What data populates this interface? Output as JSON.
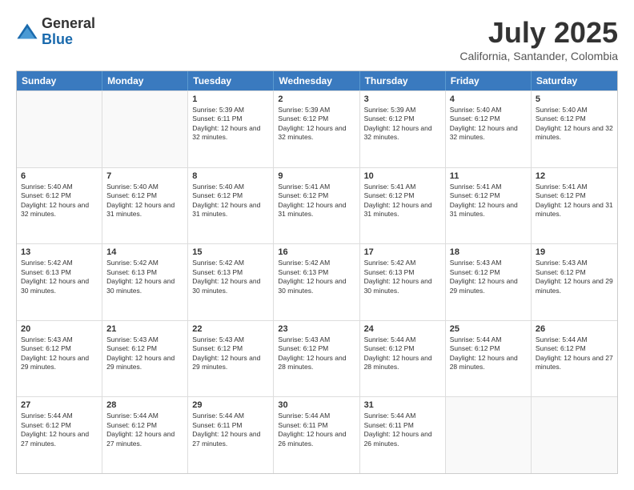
{
  "logo": {
    "line1": "General",
    "line2": "Blue"
  },
  "title": "July 2025",
  "subtitle": "California, Santander, Colombia",
  "header_days": [
    "Sunday",
    "Monday",
    "Tuesday",
    "Wednesday",
    "Thursday",
    "Friday",
    "Saturday"
  ],
  "weeks": [
    [
      {
        "day": "",
        "info": ""
      },
      {
        "day": "",
        "info": ""
      },
      {
        "day": "1",
        "info": "Sunrise: 5:39 AM\nSunset: 6:11 PM\nDaylight: 12 hours and 32 minutes."
      },
      {
        "day": "2",
        "info": "Sunrise: 5:39 AM\nSunset: 6:12 PM\nDaylight: 12 hours and 32 minutes."
      },
      {
        "day": "3",
        "info": "Sunrise: 5:39 AM\nSunset: 6:12 PM\nDaylight: 12 hours and 32 minutes."
      },
      {
        "day": "4",
        "info": "Sunrise: 5:40 AM\nSunset: 6:12 PM\nDaylight: 12 hours and 32 minutes."
      },
      {
        "day": "5",
        "info": "Sunrise: 5:40 AM\nSunset: 6:12 PM\nDaylight: 12 hours and 32 minutes."
      }
    ],
    [
      {
        "day": "6",
        "info": "Sunrise: 5:40 AM\nSunset: 6:12 PM\nDaylight: 12 hours and 32 minutes."
      },
      {
        "day": "7",
        "info": "Sunrise: 5:40 AM\nSunset: 6:12 PM\nDaylight: 12 hours and 31 minutes."
      },
      {
        "day": "8",
        "info": "Sunrise: 5:40 AM\nSunset: 6:12 PM\nDaylight: 12 hours and 31 minutes."
      },
      {
        "day": "9",
        "info": "Sunrise: 5:41 AM\nSunset: 6:12 PM\nDaylight: 12 hours and 31 minutes."
      },
      {
        "day": "10",
        "info": "Sunrise: 5:41 AM\nSunset: 6:12 PM\nDaylight: 12 hours and 31 minutes."
      },
      {
        "day": "11",
        "info": "Sunrise: 5:41 AM\nSunset: 6:12 PM\nDaylight: 12 hours and 31 minutes."
      },
      {
        "day": "12",
        "info": "Sunrise: 5:41 AM\nSunset: 6:12 PM\nDaylight: 12 hours and 31 minutes."
      }
    ],
    [
      {
        "day": "13",
        "info": "Sunrise: 5:42 AM\nSunset: 6:13 PM\nDaylight: 12 hours and 30 minutes."
      },
      {
        "day": "14",
        "info": "Sunrise: 5:42 AM\nSunset: 6:13 PM\nDaylight: 12 hours and 30 minutes."
      },
      {
        "day": "15",
        "info": "Sunrise: 5:42 AM\nSunset: 6:13 PM\nDaylight: 12 hours and 30 minutes."
      },
      {
        "day": "16",
        "info": "Sunrise: 5:42 AM\nSunset: 6:13 PM\nDaylight: 12 hours and 30 minutes."
      },
      {
        "day": "17",
        "info": "Sunrise: 5:42 AM\nSunset: 6:13 PM\nDaylight: 12 hours and 30 minutes."
      },
      {
        "day": "18",
        "info": "Sunrise: 5:43 AM\nSunset: 6:12 PM\nDaylight: 12 hours and 29 minutes."
      },
      {
        "day": "19",
        "info": "Sunrise: 5:43 AM\nSunset: 6:12 PM\nDaylight: 12 hours and 29 minutes."
      }
    ],
    [
      {
        "day": "20",
        "info": "Sunrise: 5:43 AM\nSunset: 6:12 PM\nDaylight: 12 hours and 29 minutes."
      },
      {
        "day": "21",
        "info": "Sunrise: 5:43 AM\nSunset: 6:12 PM\nDaylight: 12 hours and 29 minutes."
      },
      {
        "day": "22",
        "info": "Sunrise: 5:43 AM\nSunset: 6:12 PM\nDaylight: 12 hours and 29 minutes."
      },
      {
        "day": "23",
        "info": "Sunrise: 5:43 AM\nSunset: 6:12 PM\nDaylight: 12 hours and 28 minutes."
      },
      {
        "day": "24",
        "info": "Sunrise: 5:44 AM\nSunset: 6:12 PM\nDaylight: 12 hours and 28 minutes."
      },
      {
        "day": "25",
        "info": "Sunrise: 5:44 AM\nSunset: 6:12 PM\nDaylight: 12 hours and 28 minutes."
      },
      {
        "day": "26",
        "info": "Sunrise: 5:44 AM\nSunset: 6:12 PM\nDaylight: 12 hours and 27 minutes."
      }
    ],
    [
      {
        "day": "27",
        "info": "Sunrise: 5:44 AM\nSunset: 6:12 PM\nDaylight: 12 hours and 27 minutes."
      },
      {
        "day": "28",
        "info": "Sunrise: 5:44 AM\nSunset: 6:12 PM\nDaylight: 12 hours and 27 minutes."
      },
      {
        "day": "29",
        "info": "Sunrise: 5:44 AM\nSunset: 6:11 PM\nDaylight: 12 hours and 27 minutes."
      },
      {
        "day": "30",
        "info": "Sunrise: 5:44 AM\nSunset: 6:11 PM\nDaylight: 12 hours and 26 minutes."
      },
      {
        "day": "31",
        "info": "Sunrise: 5:44 AM\nSunset: 6:11 PM\nDaylight: 12 hours and 26 minutes."
      },
      {
        "day": "",
        "info": ""
      },
      {
        "day": "",
        "info": ""
      }
    ]
  ]
}
